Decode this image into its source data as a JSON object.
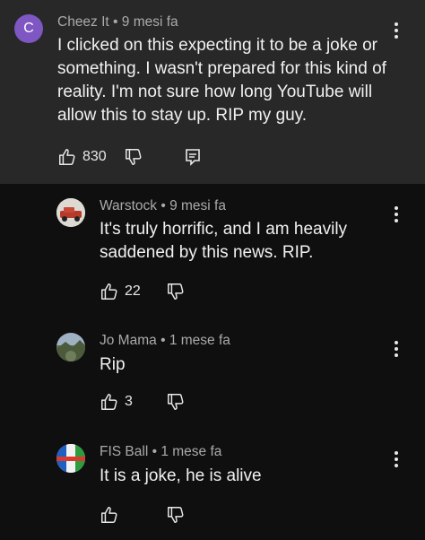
{
  "parent_comment": {
    "avatar_letter": "C",
    "author": "Cheez It",
    "time": "9 mesi fa",
    "lines": [
      "I clicked on this expecting it to be a joke or",
      "something. I wasn't prepared for this kind of",
      "reality. I'm not sure how long YouTube will",
      "allow this to stay up. RIP my guy."
    ],
    "like_count": "830",
    "avatar_color": "#7e57c2"
  },
  "replies": [
    {
      "author": "Warstock",
      "time": "9 mesi fa",
      "lines": [
        "It's truly horrific, and I am heavily",
        "saddened by this news. RIP."
      ],
      "like_count": "22"
    },
    {
      "author": "Jo Mama",
      "time": "1 mese fa",
      "lines": [
        "Rip"
      ],
      "like_count": "3"
    },
    {
      "author": "FIS Ball",
      "time": "1 mese fa",
      "lines": [
        "It is a joke, he is alive"
      ],
      "like_count": ""
    }
  ],
  "separator": "•",
  "icons": {
    "like": "thumb-up-icon",
    "dislike": "thumb-down-icon",
    "reply": "reply-icon",
    "menu": "more-vert-icon"
  }
}
